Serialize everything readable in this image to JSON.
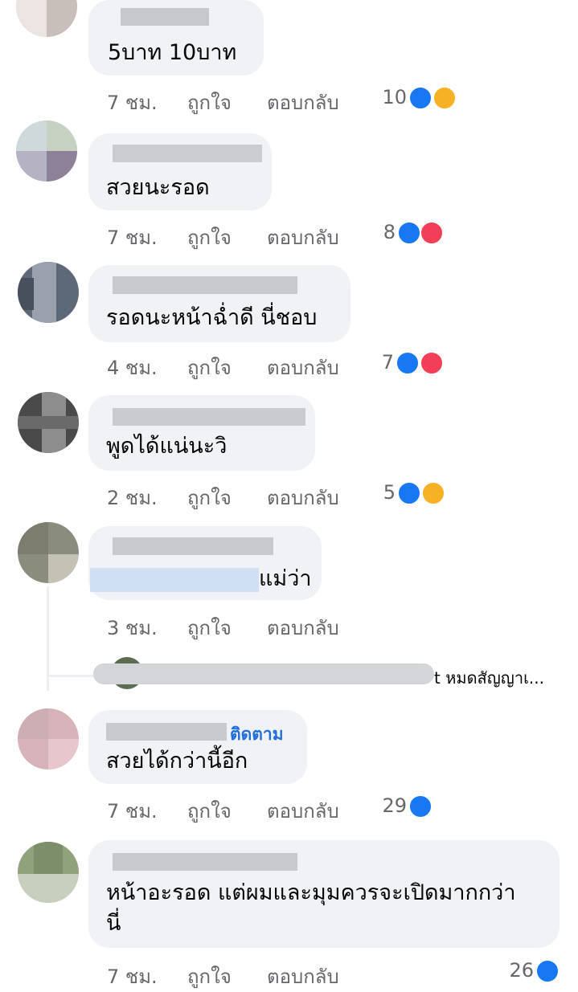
{
  "comments": [
    {
      "text": "5บาท 10บาท",
      "time": "7 ชม.",
      "like": "ถูกใจ",
      "reply": "ตอบกลับ",
      "count": "10",
      "reactions": [
        "like-icon",
        "haha-icon"
      ]
    },
    {
      "text": "สวยนะรอด",
      "time": "7 ชม.",
      "like": "ถูกใจ",
      "reply": "ตอบกลับ",
      "count": "8",
      "reactions": [
        "like-icon",
        "love-icon"
      ]
    },
    {
      "text": "รอดนะหน้าฉ่ำดี นี่ชอบ",
      "time": "4 ชม.",
      "like": "ถูกใจ",
      "reply": "ตอบกลับ",
      "count": "7",
      "reactions": [
        "like-icon",
        "love-icon"
      ]
    },
    {
      "text": "พูดได้แน่นะวิ",
      "time": "2 ชม.",
      "like": "ถูกใจ",
      "reply": "ตอบกลับ",
      "count": "5",
      "reactions": [
        "like-icon",
        "haha-icon"
      ]
    },
    {
      "text": "แม่ว่า",
      "time": "3 ชม.",
      "like": "ถูกใจ",
      "reply": "ตอบกลับ",
      "count": "",
      "reactions": []
    },
    {
      "text": "สวยได้กว่านี้อีก",
      "time": "7 ชม.",
      "like": "ถูกใจ",
      "reply": "ตอบกลับ",
      "count": "29",
      "reactions": [
        "like-icon"
      ],
      "follow": "ติดตาม"
    },
    {
      "text_line1": "หน้าอะรอด แต่ผมและมุมควรจะเปิดมากกว่า",
      "text_line2": "นี่",
      "time": "7 ชม.",
      "like": "ถูกใจ",
      "reply": "ตอบกลับ",
      "count": "26",
      "reactions": [
        "like-icon"
      ]
    }
  ],
  "reply_preview": {
    "text": "t หมดสัญญาเ..."
  },
  "colors": {
    "like": "#1877f2",
    "love": "#f33e58",
    "haha": "#f7b125",
    "bubble": "#f0f2f5",
    "meta": "#65676b",
    "follow": "#216fdb"
  }
}
